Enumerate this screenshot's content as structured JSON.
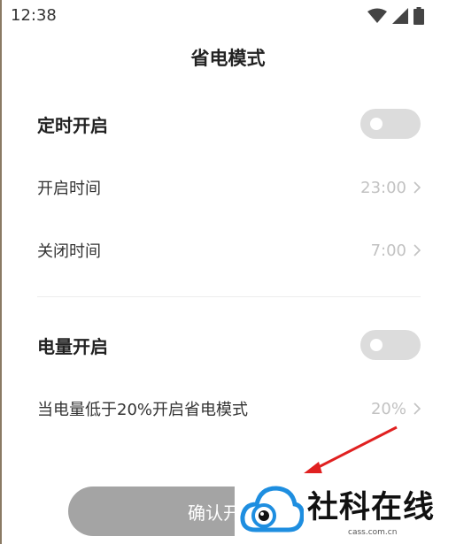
{
  "status_bar": {
    "time": "12:38",
    "icons": [
      "wifi-icon",
      "cellular-signal-icon",
      "battery-icon"
    ]
  },
  "header": {
    "title": "省电模式"
  },
  "scheduled": {
    "title": "定时开启",
    "toggle_on": false,
    "start": {
      "label": "开启时间",
      "value": "23:00"
    },
    "end": {
      "label": "关闭时间",
      "value": "7:00"
    }
  },
  "battery_level": {
    "title": "电量开启",
    "toggle_on": false,
    "threshold": {
      "label": "当电量低于20%开启省电模式",
      "value": "20%"
    }
  },
  "footer": {
    "confirm_label": "确认开"
  },
  "watermark": {
    "name": "社科在线",
    "domain": "cass.com.cn"
  },
  "colors": {
    "toggle_off": "#dcdcdc",
    "button_disabled": "#a4a4a4",
    "value_text": "#c2c2c2",
    "overlay_arrow": "#e02020",
    "logo_blue": "#1e8ee0"
  }
}
